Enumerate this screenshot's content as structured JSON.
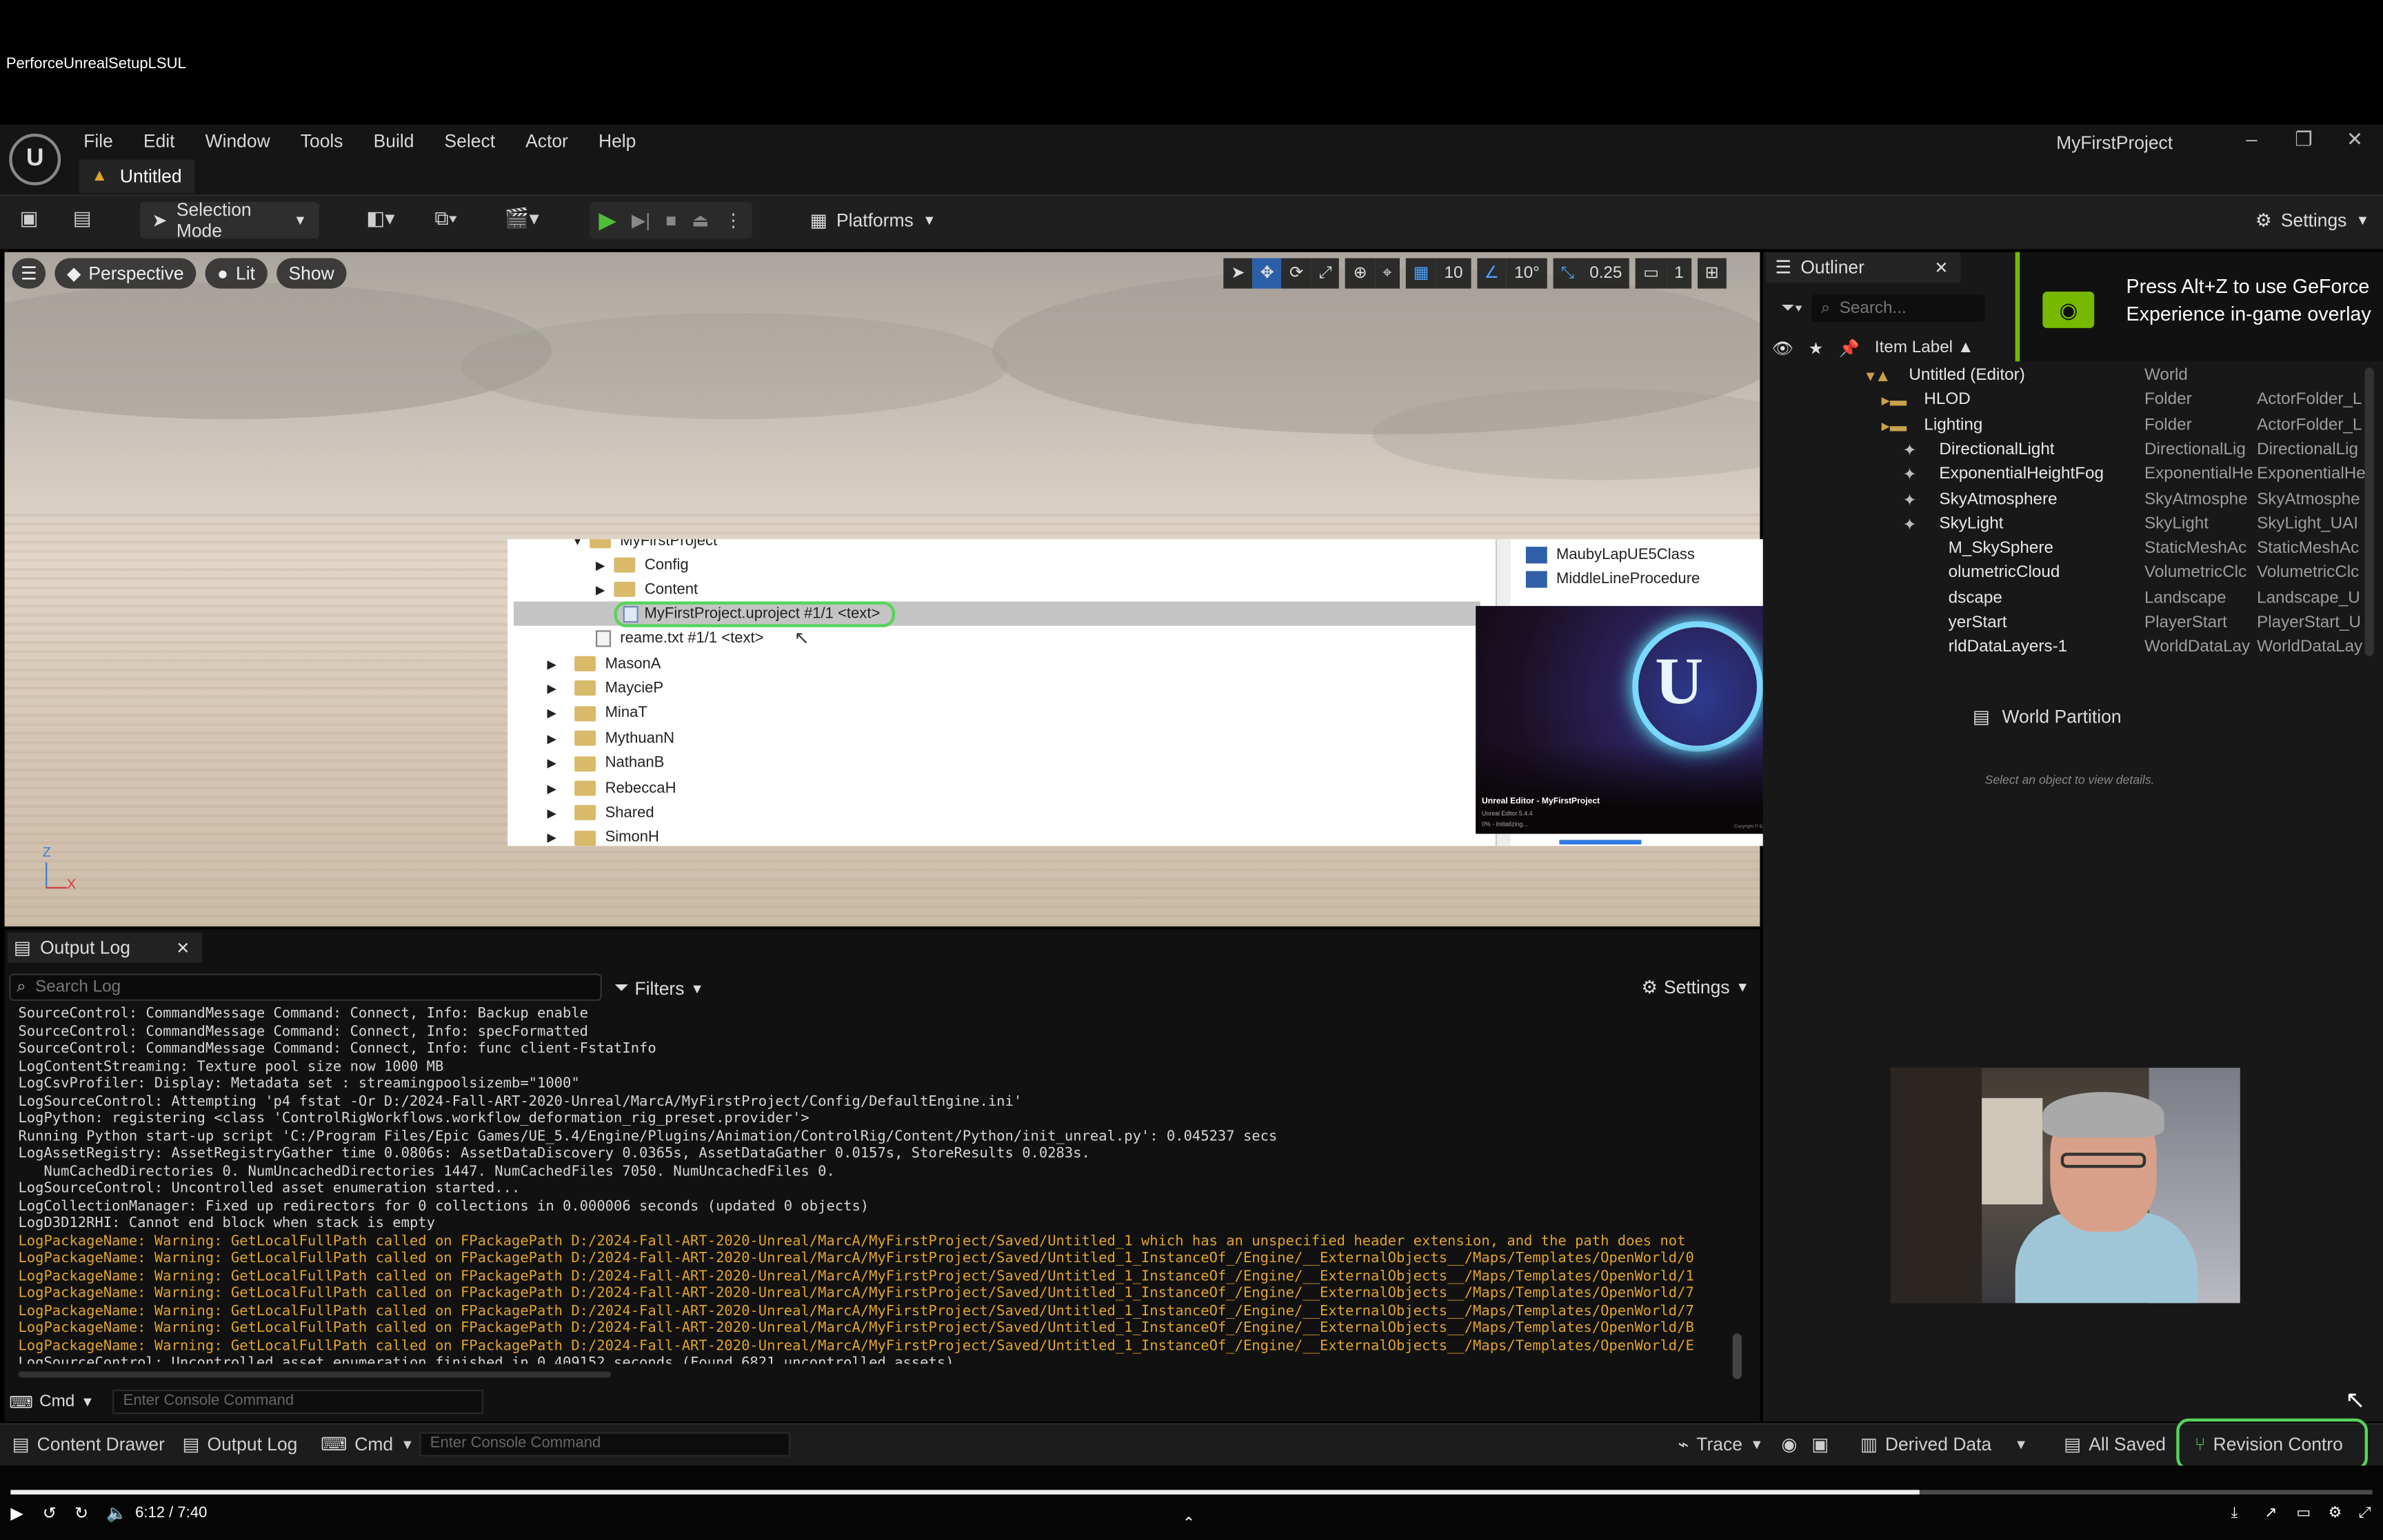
{
  "video": {
    "title": "PerforceUnrealSetupLSUL",
    "time": "6:12 / 7:40",
    "progress": 0.808
  },
  "app": {
    "logo": "U",
    "menu": [
      "File",
      "Edit",
      "Window",
      "Tools",
      "Build",
      "Select",
      "Actor",
      "Help"
    ],
    "tab": "Untitled",
    "project": "MyFirstProject",
    "window_controls": [
      "–",
      "❐",
      "✕"
    ]
  },
  "toolbar": {
    "selection_mode": "Selection Mode",
    "platforms": "Platforms",
    "settings": "Settings"
  },
  "viewport": {
    "perspective": "Perspective",
    "lit": "Lit",
    "show": "Show",
    "grid_snap": "10",
    "rot_snap": "10°",
    "scale_snap": "0.25",
    "camera_speed": "1",
    "axis_z": "Z",
    "axis_x": "X"
  },
  "overlay": {
    "tree_top": "MyFirstProject",
    "items": [
      {
        "label": "Config"
      },
      {
        "label": "Content"
      }
    ],
    "selected_file": "MyFirstProject.uproject #1/1 <text>",
    "readme": "reame.txt #1/1 <text>",
    "folders": [
      "MasonA",
      "MaycieP",
      "MinaT",
      "MythuanN",
      "NathanB",
      "RebeccaH",
      "Shared",
      "SimonH"
    ],
    "right_items": [
      "MaubyLapUE5Class",
      "MiddleLineProcedure"
    ],
    "splash_title": "Unreal Editor - MyFirstProject",
    "splash_version": "Unreal Editor 5.4.4",
    "splash_status": "0% - Initializing...",
    "splash_copyright": "Copyright © Epic Games, Inc. All rights reserved."
  },
  "outliner": {
    "tab": "Outliner",
    "search_placeholder": "Search...",
    "header": "Item Label ▲",
    "rows": [
      {
        "label": "Untitled (Editor)",
        "type": "World",
        "folder": ""
      },
      {
        "label": "HLOD",
        "type": "Folder",
        "folder": "ActorFolder_L"
      },
      {
        "label": "Lighting",
        "type": "Folder",
        "folder": "ActorFolder_L"
      },
      {
        "label": "DirectionalLight",
        "type": "DirectionalLig",
        "folder": "DirectionalLig"
      },
      {
        "label": "ExponentialHeightFog",
        "type": "ExponentialHe",
        "folder": "ExponentialHe"
      },
      {
        "label": "SkyAtmosphere",
        "type": "SkyAtmosphe",
        "folder": "SkyAtmosphe"
      },
      {
        "label": "SkyLight",
        "type": "SkyLight",
        "folder": "SkyLight_UAI"
      },
      {
        "label": "M_SkySphere",
        "type": "StaticMeshAc",
        "folder": "StaticMeshAc"
      },
      {
        "label": "olumetricCloud",
        "type": "VolumetricClc",
        "folder": "VolumetricClc"
      },
      {
        "label": "dscape",
        "type": "Landscape",
        "folder": "Landscape_U"
      },
      {
        "label": "yerStart",
        "type": "PlayerStart",
        "folder": "PlayerStart_U"
      },
      {
        "label": "rldDataLayers-1",
        "type": "WorldDataLay",
        "folder": "WorldDataLay"
      }
    ],
    "world_partition": "World Partition",
    "details_hint": "Select an object to view details."
  },
  "nvidia": {
    "message": "Press Alt+Z to use GeForce Experience in-game overlay"
  },
  "output_log": {
    "tab": "Output Log",
    "search_placeholder": "Search Log",
    "filters": "Filters",
    "settings": "Settings",
    "lines": [
      {
        "t": "SourceControl: CommandMessage Command: Connect, Info: Backup enable",
        "w": false
      },
      {
        "t": "SourceControl: CommandMessage Command: Connect, Info: specFormatted",
        "w": false
      },
      {
        "t": "SourceControl: CommandMessage Command: Connect, Info: func client-FstatInfo",
        "w": false
      },
      {
        "t": "LogContentStreaming: Texture pool size now 1000 MB",
        "w": false
      },
      {
        "t": "LogCsvProfiler: Display: Metadata set : streamingpoolsizemb=\"1000\"",
        "w": false
      },
      {
        "t": "LogSourceControl: Attempting 'p4 fstat -Or D:/2024-Fall-ART-2020-Unreal/MarcA/MyFirstProject/Config/DefaultEngine.ini'",
        "w": false
      },
      {
        "t": "LogPython: registering <class 'ControlRigWorkflows.workflow_deformation_rig_preset.provider'>",
        "w": false
      },
      {
        "t": "Running Python start-up script 'C:/Program Files/Epic Games/UE_5.4/Engine/Plugins/Animation/ControlRig/Content/Python/init_unreal.py': 0.045237 secs",
        "w": false
      },
      {
        "t": "LogAssetRegistry: AssetRegistryGather time 0.0806s: AssetDataDiscovery 0.0365s, AssetDataGather 0.0157s, StoreResults 0.0283s.",
        "w": false
      },
      {
        "t": "   NumCachedDirectories 0. NumUncachedDirectories 1447. NumCachedFiles 7050. NumUncachedFiles 0.",
        "w": false
      },
      {
        "t": "LogSourceControl: Uncontrolled asset enumeration started...",
        "w": false
      },
      {
        "t": "LogCollectionManager: Fixed up redirectors for 0 collections in 0.000006 seconds (updated 0 objects)",
        "w": false
      },
      {
        "t": "LogD3D12RHI: Cannot end block when stack is empty",
        "w": false
      },
      {
        "t": "LogPackageName: Warning: GetLocalFullPath called on FPackagePath D:/2024-Fall-ART-2020-Unreal/MarcA/MyFirstProject/Saved/Untitled_1 which has an unspecified header extension, and the path does not",
        "w": true
      },
      {
        "t": "LogPackageName: Warning: GetLocalFullPath called on FPackagePath D:/2024-Fall-ART-2020-Unreal/MarcA/MyFirstProject/Saved/Untitled_1_InstanceOf_/Engine/__ExternalObjects__/Maps/Templates/OpenWorld/0",
        "w": true
      },
      {
        "t": "LogPackageName: Warning: GetLocalFullPath called on FPackagePath D:/2024-Fall-ART-2020-Unreal/MarcA/MyFirstProject/Saved/Untitled_1_InstanceOf_/Engine/__ExternalObjects__/Maps/Templates/OpenWorld/1",
        "w": true
      },
      {
        "t": "LogPackageName: Warning: GetLocalFullPath called on FPackagePath D:/2024-Fall-ART-2020-Unreal/MarcA/MyFirstProject/Saved/Untitled_1_InstanceOf_/Engine/__ExternalObjects__/Maps/Templates/OpenWorld/7",
        "w": true
      },
      {
        "t": "LogPackageName: Warning: GetLocalFullPath called on FPackagePath D:/2024-Fall-ART-2020-Unreal/MarcA/MyFirstProject/Saved/Untitled_1_InstanceOf_/Engine/__ExternalObjects__/Maps/Templates/OpenWorld/7",
        "w": true
      },
      {
        "t": "LogPackageName: Warning: GetLocalFullPath called on FPackagePath D:/2024-Fall-ART-2020-Unreal/MarcA/MyFirstProject/Saved/Untitled_1_InstanceOf_/Engine/__ExternalObjects__/Maps/Templates/OpenWorld/B",
        "w": true
      },
      {
        "t": "LogPackageName: Warning: GetLocalFullPath called on FPackagePath D:/2024-Fall-ART-2020-Unreal/MarcA/MyFirstProject/Saved/Untitled_1_InstanceOf_/Engine/__ExternalObjects__/Maps/Templates/OpenWorld/E",
        "w": true
      },
      {
        "t": "LogSourceControl: Uncontrolled asset enumeration finished in 0.409152 seconds (Found 6821 uncontrolled assets)",
        "w": false
      }
    ],
    "cmd_label": "Cmd",
    "cmd_placeholder": "Enter Console Command"
  },
  "statusbar": {
    "content_drawer": "Content Drawer",
    "output_log": "Output Log",
    "cmd": "Cmd",
    "cmd_placeholder": "Enter Console Command",
    "trace": "Trace",
    "derived_data": "Derived Data",
    "all_saved": "All Saved",
    "revision_control": "Revision Contro"
  },
  "colors": {
    "accent_green": "#56d45a",
    "warning": "#e0a42c",
    "play_green": "#4fbf3a"
  }
}
